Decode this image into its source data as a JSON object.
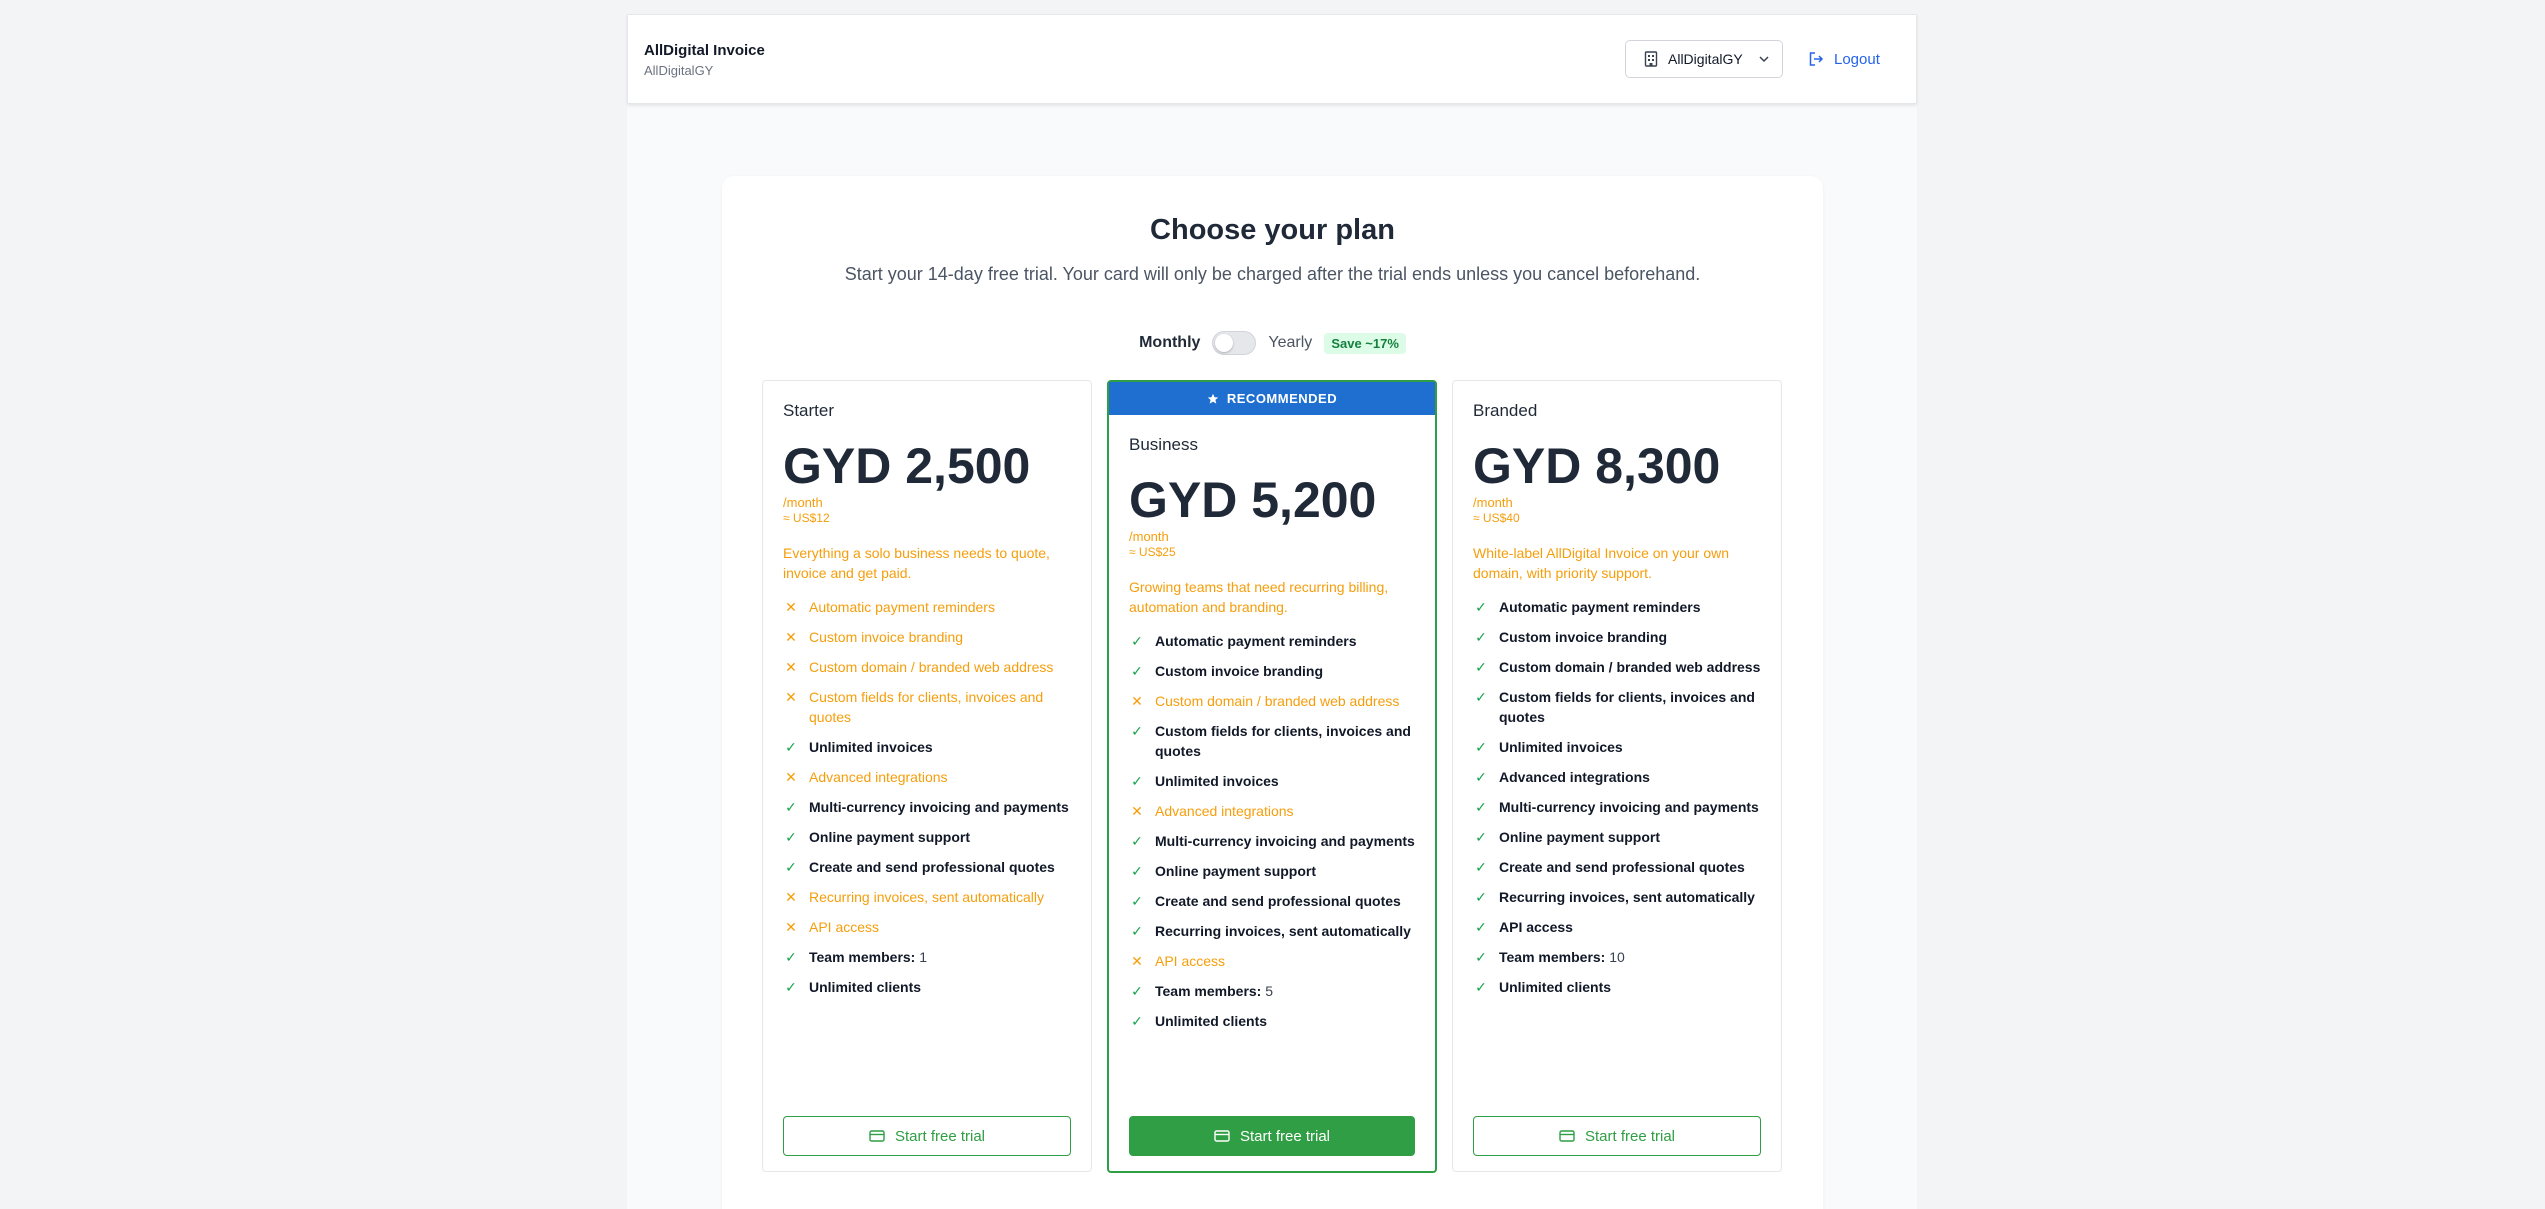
{
  "header": {
    "app_name": "AllDigital Invoice",
    "org_name": "AllDigitalGY",
    "org_select_label": "AllDigitalGY",
    "logout_label": "Logout"
  },
  "page": {
    "title": "Choose your plan",
    "subtitle": "Start your 14-day free trial. Your card will only be charged after the trial ends unless you cancel beforehand."
  },
  "billing": {
    "monthly_label": "Monthly",
    "yearly_label": "Yearly",
    "save_badge": "Save ~17%",
    "yearly_selected": false
  },
  "colors": {
    "accent_green": "#2f9e44",
    "recommended_blue": "#1f6fd1",
    "link_blue": "#2563eb",
    "muted_orange": "#f59e0b"
  },
  "plans": [
    {
      "name": "Starter",
      "price": "GYD 2,500",
      "period": "/month",
      "usd": "≈ US$12",
      "description": "Everything a solo business needs to quote, invoice and get paid.",
      "cta": "Start free trial",
      "features": [
        {
          "label": "Automatic payment reminders",
          "included": false
        },
        {
          "label": "Custom invoice branding",
          "included": false
        },
        {
          "label": "Custom domain / branded web address",
          "included": false
        },
        {
          "label": "Custom fields for clients, invoices and quotes",
          "included": false
        },
        {
          "label": "Unlimited invoices",
          "included": true
        },
        {
          "label": "Advanced integrations",
          "included": false
        },
        {
          "label": "Multi-currency invoicing and payments",
          "included": true
        },
        {
          "label": "Online payment support",
          "included": true
        },
        {
          "label": "Create and send professional quotes",
          "included": true
        },
        {
          "label": "Recurring invoices, sent automatically",
          "included": false
        },
        {
          "label": "API access",
          "included": false
        },
        {
          "label": "Team members:",
          "included": true,
          "value": "1"
        },
        {
          "label": "Unlimited clients",
          "included": true
        }
      ]
    },
    {
      "name": "Business",
      "badge": "RECOMMENDED",
      "price": "GYD 5,200",
      "period": "/month",
      "usd": "≈ US$25",
      "description": "Growing teams that need recurring billing, automation and branding.",
      "cta": "Start free trial",
      "features": [
        {
          "label": "Automatic payment reminders",
          "included": true
        },
        {
          "label": "Custom invoice branding",
          "included": true
        },
        {
          "label": "Custom domain / branded web address",
          "included": false
        },
        {
          "label": "Custom fields for clients, invoices and quotes",
          "included": true
        },
        {
          "label": "Unlimited invoices",
          "included": true
        },
        {
          "label": "Advanced integrations",
          "included": false
        },
        {
          "label": "Multi-currency invoicing and payments",
          "included": true
        },
        {
          "label": "Online payment support",
          "included": true
        },
        {
          "label": "Create and send professional quotes",
          "included": true
        },
        {
          "label": "Recurring invoices, sent automatically",
          "included": true
        },
        {
          "label": "API access",
          "included": false
        },
        {
          "label": "Team members:",
          "included": true,
          "value": "5"
        },
        {
          "label": "Unlimited clients",
          "included": true
        }
      ]
    },
    {
      "name": "Branded",
      "price": "GYD 8,300",
      "period": "/month",
      "usd": "≈ US$40",
      "description": "White-label AllDigital Invoice on your own domain, with priority support.",
      "cta": "Start free trial",
      "features": [
        {
          "label": "Automatic payment reminders",
          "included": true
        },
        {
          "label": "Custom invoice branding",
          "included": true
        },
        {
          "label": "Custom domain / branded web address",
          "included": true
        },
        {
          "label": "Custom fields for clients, invoices and quotes",
          "included": true
        },
        {
          "label": "Unlimited invoices",
          "included": true
        },
        {
          "label": "Advanced integrations",
          "included": true
        },
        {
          "label": "Multi-currency invoicing and payments",
          "included": true
        },
        {
          "label": "Online payment support",
          "included": true
        },
        {
          "label": "Create and send professional quotes",
          "included": true
        },
        {
          "label": "Recurring invoices, sent automatically",
          "included": true
        },
        {
          "label": "API access",
          "included": true
        },
        {
          "label": "Team members:",
          "included": true,
          "value": "10"
        },
        {
          "label": "Unlimited clients",
          "included": true
        }
      ]
    }
  ]
}
